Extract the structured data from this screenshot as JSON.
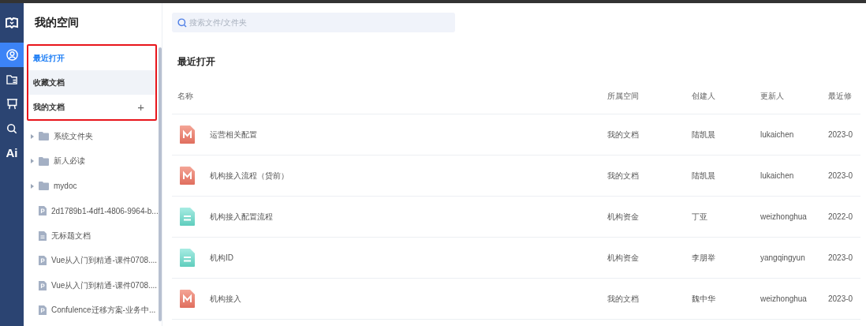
{
  "rail": {
    "items": [
      {
        "kind": "person",
        "selected": true
      },
      {
        "kind": "folder",
        "selected": false
      },
      {
        "kind": "board",
        "selected": false
      },
      {
        "kind": "search",
        "selected": false
      },
      {
        "kind": "text",
        "label": "Ai",
        "selected": false
      }
    ]
  },
  "sidebar": {
    "title": "我的空间",
    "highlighted": true,
    "nav": [
      {
        "label": "最近打开",
        "selected": true,
        "hovered": false
      },
      {
        "label": "收藏文档",
        "selected": false,
        "hovered": true
      },
      {
        "label": "我的文档",
        "selected": false,
        "hovered": false,
        "add_label": "+"
      }
    ],
    "tree": [
      {
        "kind": "folder",
        "label": "系统文件夹"
      },
      {
        "kind": "folder",
        "label": "新人必读"
      },
      {
        "kind": "folder",
        "label": "mydoc"
      },
      {
        "kind": "slides",
        "label": "2d1789b1-4df1-4806-9964-b..."
      },
      {
        "kind": "doc",
        "label": "无标题文档"
      },
      {
        "kind": "slides",
        "label": "Vue从入门到精通-课件0708...."
      },
      {
        "kind": "slides",
        "label": "Vue从入门到精通-课件0708...."
      },
      {
        "kind": "slides",
        "label": "Confulence迁移方案-业务中..."
      }
    ]
  },
  "search": {
    "placeholder": "搜索文件/文件夹"
  },
  "section_title": "最近打开",
  "table": {
    "columns": [
      "名称",
      "所属空间",
      "创建人",
      "更新人",
      "最近修"
    ],
    "rows": [
      {
        "kind": "mind",
        "name": "运营相关配置",
        "space": "我的文档",
        "creator": "陆凯晨",
        "updater": "lukaichen",
        "modified": "2023-0"
      },
      {
        "kind": "mind",
        "name": "机构接入流程（贷前）",
        "space": "我的文档",
        "creator": "陆凯晨",
        "updater": "lukaichen",
        "modified": "2023-0"
      },
      {
        "kind": "doc",
        "name": "机构接入配置流程",
        "space": "机构资金",
        "creator": "丁亚",
        "updater": "weizhonghua",
        "modified": "2022-0"
      },
      {
        "kind": "doc",
        "name": "机构ID",
        "space": "机构资金",
        "creator": "李朋举",
        "updater": "yangqingyun",
        "modified": "2023-0"
      },
      {
        "kind": "mind",
        "name": "机构接入",
        "space": "我的文档",
        "creator": "魏中华",
        "updater": "weizhonghua",
        "modified": "2023-0"
      }
    ]
  }
}
